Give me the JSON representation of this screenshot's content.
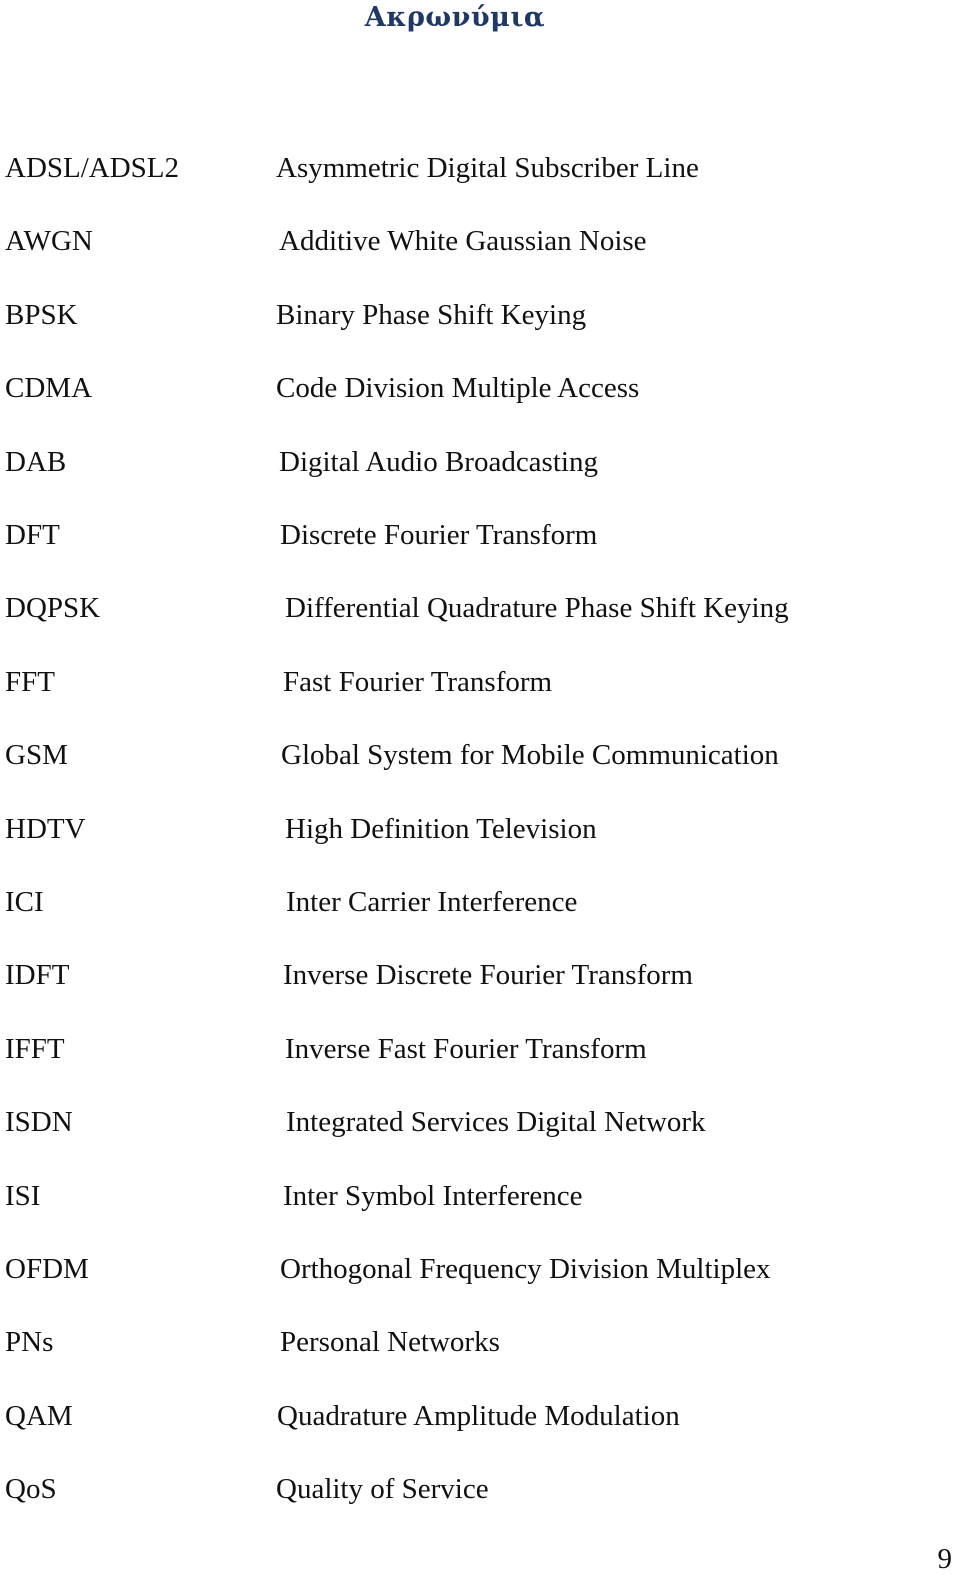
{
  "page": {
    "title": "Ακρωνύμια",
    "page_number": "9",
    "title_color": "#1f3864"
  },
  "acronyms": [
    {
      "abbr": "ADSL/ADSL2",
      "expansion": "Asymmetric Digital Subscriber Line"
    },
    {
      "abbr": "AWGN",
      "expansion": "Additive White Gaussian Noise"
    },
    {
      "abbr": "BPSK",
      "expansion": "Binary Phase Shift Keying"
    },
    {
      "abbr": "CDMA",
      "expansion": "Code Division Multiple Access"
    },
    {
      "abbr": "DAB",
      "expansion": "Digital Audio Broadcasting"
    },
    {
      "abbr": "DFT",
      "expansion": "Discrete Fourier Transform"
    },
    {
      "abbr": "DQPSK",
      "expansion": "Differential Quadrature Phase Shift Keying"
    },
    {
      "abbr": "FFT",
      "expansion": "Fast Fourier Transform"
    },
    {
      "abbr": "GSM",
      "expansion": "Global System for Mobile Communication"
    },
    {
      "abbr": "HDTV",
      "expansion": "High Definition Television"
    },
    {
      "abbr": "ICI",
      "expansion": "Inter Carrier Interference"
    },
    {
      "abbr": "IDFT",
      "expansion": "Inverse Discrete Fourier Transform"
    },
    {
      "abbr": "IFFT",
      "expansion": "Inverse Fast Fourier Transform"
    },
    {
      "abbr": "ISDN",
      "expansion": "Integrated Services Digital Network"
    },
    {
      "abbr": "ISI",
      "expansion": "Inter Symbol Interference"
    },
    {
      "abbr": "OFDM",
      "expansion": "Orthogonal Frequency Division Multiplex"
    },
    {
      "abbr": "PNs",
      "expansion": "Personal Networks"
    },
    {
      "abbr": "QAM",
      "expansion": "Quadrature Amplitude Modulation"
    },
    {
      "abbr": "QoS",
      "expansion": "Quality of Service"
    }
  ]
}
